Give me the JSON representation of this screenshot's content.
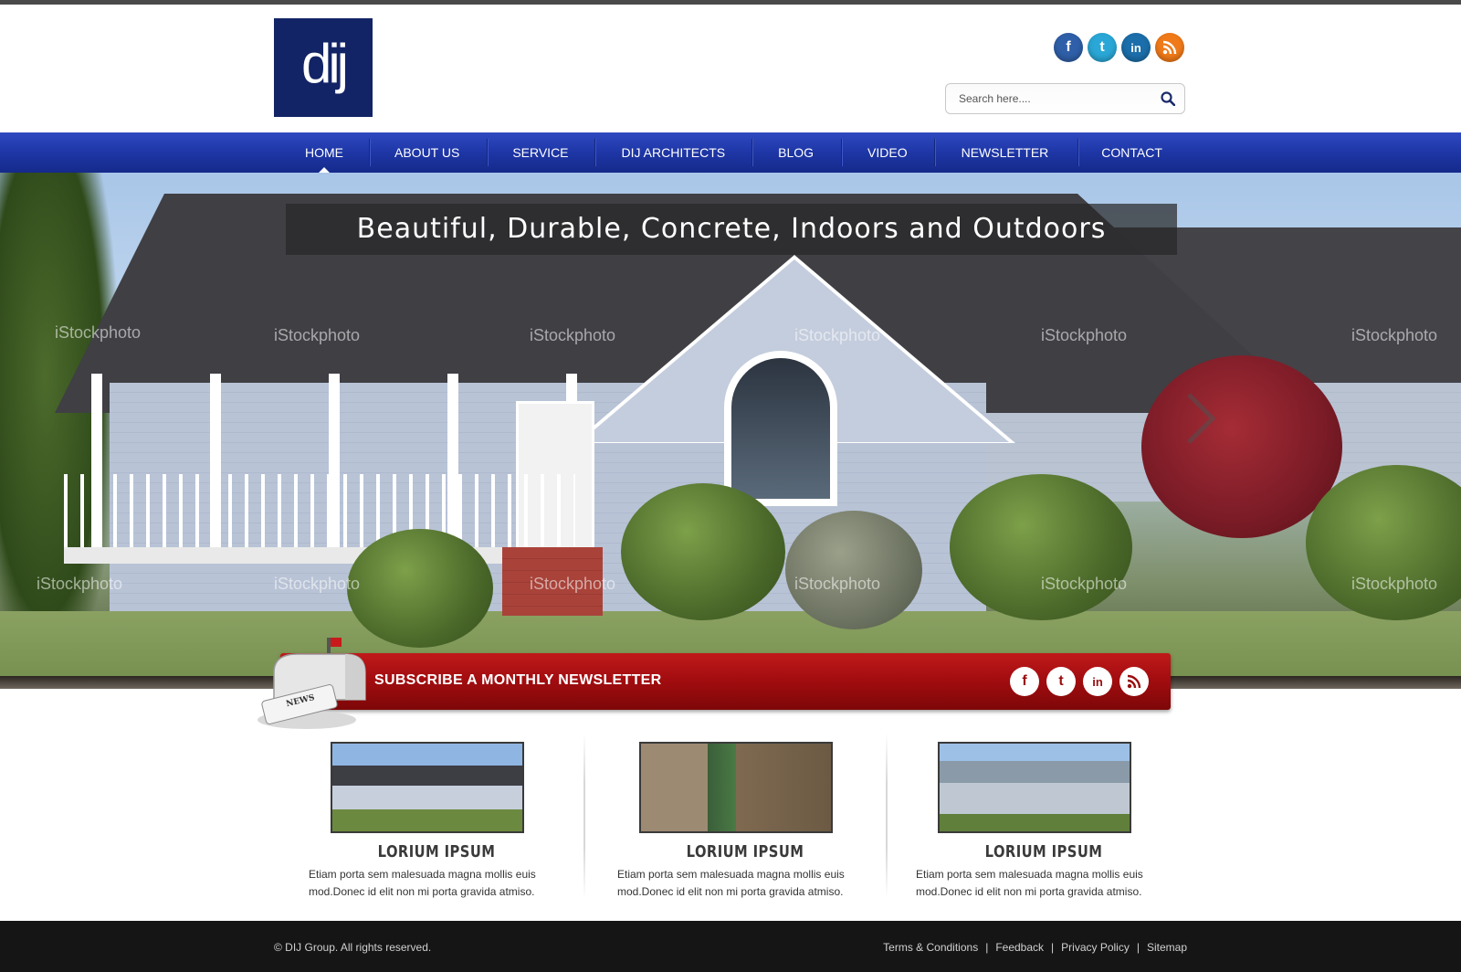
{
  "logo": {
    "text": "dij"
  },
  "header": {
    "social": [
      {
        "name": "facebook",
        "glyph": "f",
        "color": "#2f5fa8"
      },
      {
        "name": "twitter",
        "glyph": "t",
        "color": "#2aa7d6"
      },
      {
        "name": "linkedin",
        "glyph": "in",
        "color": "#1b6eaa"
      },
      {
        "name": "rss",
        "glyph": "rss",
        "color": "#f07a19"
      }
    ],
    "search": {
      "placeholder": "Search here....",
      "value": ""
    }
  },
  "nav": {
    "items": [
      {
        "label": "HOME",
        "active": true
      },
      {
        "label": "ABOUT US"
      },
      {
        "label": "SERVICE"
      },
      {
        "label": "DIJ ARCHITECTS"
      },
      {
        "label": "BLOG"
      },
      {
        "label": "VIDEO"
      },
      {
        "label": "NEWSLETTER"
      },
      {
        "label": "CONTACT"
      }
    ]
  },
  "hero": {
    "caption": "Beautiful, Durable, Concrete, Indoors and Outdoors",
    "watermark": "iStockphoto"
  },
  "newsletter": {
    "label": "SUBSCRIBE A MONTHLY NEWSLETTER",
    "mailbox_text": "NEWS"
  },
  "features": [
    {
      "title": "LORIUM IPSUM",
      "text": "Etiam porta sem malesuada magna mollis euis mod.Donec id elit non mi porta gravida atmiso."
    },
    {
      "title": "LORIUM IPSUM",
      "text": "Etiam porta sem malesuada magna mollis euis mod.Donec id elit non mi porta gravida atmiso."
    },
    {
      "title": "LORIUM IPSUM",
      "text": "Etiam porta sem malesuada magna mollis euis mod.Donec id elit non mi porta gravida atmiso."
    }
  ],
  "footer": {
    "copyright": "© DIJ Group. All rights reserved.",
    "links": [
      "Terms & Conditions",
      "Feedback",
      "Privacy Policy",
      "Sitemap"
    ],
    "separator": "|"
  },
  "colors": {
    "nav": "#1e36a6",
    "logo_bg": "#122466",
    "newsletter_bar": "#a40d10",
    "footer": "#151515"
  }
}
